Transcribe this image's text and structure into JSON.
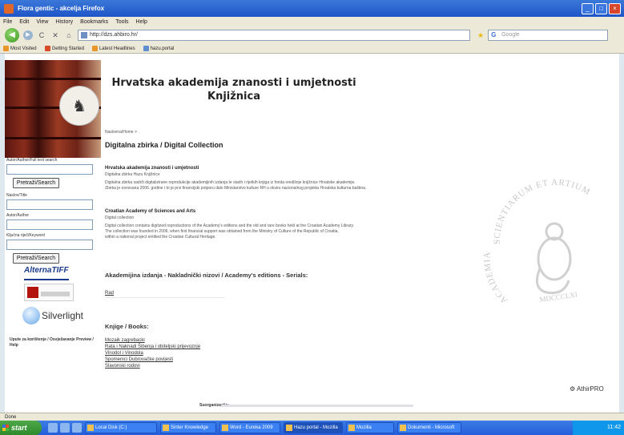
{
  "window": {
    "title": "Flora gentic - akcelja Firefox",
    "buttons": [
      "_",
      "□",
      "×"
    ]
  },
  "menu": [
    "File",
    "Edit",
    "View",
    "History",
    "Bookmarks",
    "Tools",
    "Help"
  ],
  "nav": {
    "back": "◀",
    "forward": "▶",
    "reload": "C",
    "stop": "✕",
    "home": "⌂",
    "url": "http://dzs.ahbiro.hr/",
    "search_placeholder": "Google"
  },
  "bookmarks": [
    {
      "label": "Most Visited",
      "icon": "orange"
    },
    {
      "label": "Getting Started",
      "icon": "red"
    },
    {
      "label": "Latest Headlines",
      "icon": "orange"
    },
    {
      "label": "hazu.portal",
      "icon": "blue"
    }
  ],
  "site": {
    "title_line1": "Hrvatska akademija znanosti i umjetnosti",
    "title_line2": "Knjižnica"
  },
  "sidebar": {
    "label1": "Autor/Author/Full text search",
    "button1": "Pretraži/Search",
    "label2": "Naslov/Title",
    "label3": "Autor/Author",
    "label4": "Ključna riječ/Keyword",
    "button2": "Pretraži/Search",
    "logo1": "AlternaTIFF",
    "logo2": "Silverlight",
    "note": "Upute za korištenje / Osvježavanje Preview / Help"
  },
  "main": {
    "breadcrumb": "Naslovna/Home >",
    "title": "Digitalna zbirka / Digital Collection",
    "section1_head": "Hrvatska akademija znanosti i umjetnosti",
    "section1_sub": "Digitalna zbirka Hazu Knjižnice",
    "section1_p1": "Digitalna zbirka sadrži digitalizirane reprodukcije akademijinih izdanja te starih i rijetkih knjiga iz fonda središnje knjižnice Hrvatske akademije.",
    "section1_p2": "Zbirka je osnovana 2006. godine i to je prvi financijski potporu dalo Ministarstvo kulture RH u okviru nacionalnog projekta Hrvatska kulturna baština.",
    "section2_head": "Croatian Academy of Sciences and Arts",
    "section2_sub": "Digital collection",
    "section2_p1": "Digital collection contains digitized reproductions of the Academy's editions and the old and rare books held at the Croatian Academy Library.",
    "section2_p2": "The collection was founded in 2006, when first financial support was obtained from the Ministry of Culture of the Republic of Croatia,",
    "section2_p3": "within a national project entitled the Croatian Cultural Heritage.",
    "editions_head": "Akademijina izdanja - Nakladnički nizovi / Academy's editions - Serials:",
    "editions_link": "Rad",
    "books_head": "Knjige / Books:",
    "books": [
      "Mozaik zagrebacki",
      "Rata i Naknadi Šibenja i obiteljski prijevoznje",
      "Vinodol i Vinodola",
      "Spomenici Dubrovačke povijesti",
      "Slavonski rodovi"
    ],
    "footer_label": "Suorganizacija:",
    "footer_logo": "AthirPRO"
  },
  "seal": {
    "text_top": "SCIENTIARUM ET ARTIUM",
    "text_left": "ACADEMIA",
    "text_bottom": "MDCCCLXI"
  },
  "statusbar": "Done",
  "taskbar": {
    "start": "start",
    "tasks": [
      "Local Disk (C:)",
      "Sinter Knowledge",
      "Word - Eureka 2009",
      "Hazu portal - Mozilla",
      "Mozilla",
      "Dokumenti - Microsoft"
    ],
    "clock": "11:42"
  }
}
